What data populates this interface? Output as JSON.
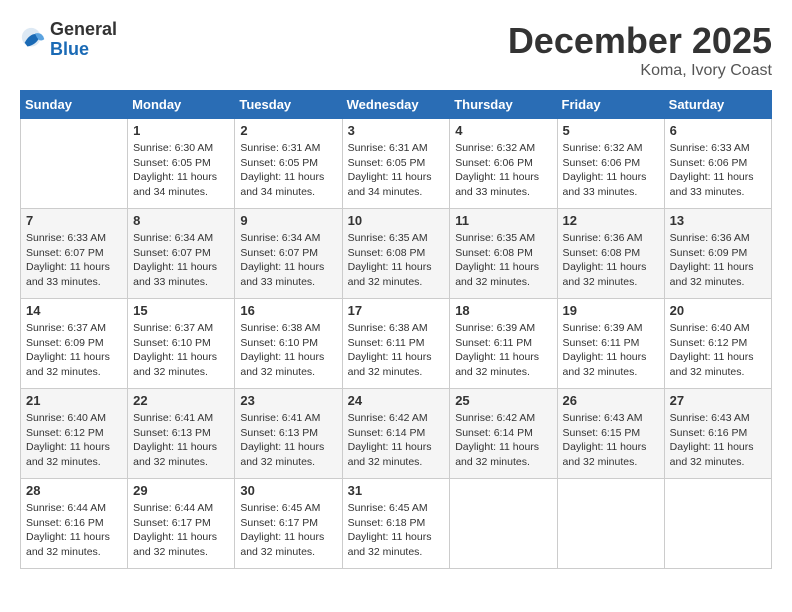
{
  "logo": {
    "general": "General",
    "blue": "Blue"
  },
  "title": "December 2025",
  "location": "Koma, Ivory Coast",
  "days_of_week": [
    "Sunday",
    "Monday",
    "Tuesday",
    "Wednesday",
    "Thursday",
    "Friday",
    "Saturday"
  ],
  "weeks": [
    [
      {
        "day": "",
        "sunrise": "",
        "sunset": "",
        "daylight": ""
      },
      {
        "day": "1",
        "sunrise": "Sunrise: 6:30 AM",
        "sunset": "Sunset: 6:05 PM",
        "daylight": "Daylight: 11 hours and 34 minutes."
      },
      {
        "day": "2",
        "sunrise": "Sunrise: 6:31 AM",
        "sunset": "Sunset: 6:05 PM",
        "daylight": "Daylight: 11 hours and 34 minutes."
      },
      {
        "day": "3",
        "sunrise": "Sunrise: 6:31 AM",
        "sunset": "Sunset: 6:05 PM",
        "daylight": "Daylight: 11 hours and 34 minutes."
      },
      {
        "day": "4",
        "sunrise": "Sunrise: 6:32 AM",
        "sunset": "Sunset: 6:06 PM",
        "daylight": "Daylight: 11 hours and 33 minutes."
      },
      {
        "day": "5",
        "sunrise": "Sunrise: 6:32 AM",
        "sunset": "Sunset: 6:06 PM",
        "daylight": "Daylight: 11 hours and 33 minutes."
      },
      {
        "day": "6",
        "sunrise": "Sunrise: 6:33 AM",
        "sunset": "Sunset: 6:06 PM",
        "daylight": "Daylight: 11 hours and 33 minutes."
      }
    ],
    [
      {
        "day": "7",
        "sunrise": "Sunrise: 6:33 AM",
        "sunset": "Sunset: 6:07 PM",
        "daylight": "Daylight: 11 hours and 33 minutes."
      },
      {
        "day": "8",
        "sunrise": "Sunrise: 6:34 AM",
        "sunset": "Sunset: 6:07 PM",
        "daylight": "Daylight: 11 hours and 33 minutes."
      },
      {
        "day": "9",
        "sunrise": "Sunrise: 6:34 AM",
        "sunset": "Sunset: 6:07 PM",
        "daylight": "Daylight: 11 hours and 33 minutes."
      },
      {
        "day": "10",
        "sunrise": "Sunrise: 6:35 AM",
        "sunset": "Sunset: 6:08 PM",
        "daylight": "Daylight: 11 hours and 32 minutes."
      },
      {
        "day": "11",
        "sunrise": "Sunrise: 6:35 AM",
        "sunset": "Sunset: 6:08 PM",
        "daylight": "Daylight: 11 hours and 32 minutes."
      },
      {
        "day": "12",
        "sunrise": "Sunrise: 6:36 AM",
        "sunset": "Sunset: 6:08 PM",
        "daylight": "Daylight: 11 hours and 32 minutes."
      },
      {
        "day": "13",
        "sunrise": "Sunrise: 6:36 AM",
        "sunset": "Sunset: 6:09 PM",
        "daylight": "Daylight: 11 hours and 32 minutes."
      }
    ],
    [
      {
        "day": "14",
        "sunrise": "Sunrise: 6:37 AM",
        "sunset": "Sunset: 6:09 PM",
        "daylight": "Daylight: 11 hours and 32 minutes."
      },
      {
        "day": "15",
        "sunrise": "Sunrise: 6:37 AM",
        "sunset": "Sunset: 6:10 PM",
        "daylight": "Daylight: 11 hours and 32 minutes."
      },
      {
        "day": "16",
        "sunrise": "Sunrise: 6:38 AM",
        "sunset": "Sunset: 6:10 PM",
        "daylight": "Daylight: 11 hours and 32 minutes."
      },
      {
        "day": "17",
        "sunrise": "Sunrise: 6:38 AM",
        "sunset": "Sunset: 6:11 PM",
        "daylight": "Daylight: 11 hours and 32 minutes."
      },
      {
        "day": "18",
        "sunrise": "Sunrise: 6:39 AM",
        "sunset": "Sunset: 6:11 PM",
        "daylight": "Daylight: 11 hours and 32 minutes."
      },
      {
        "day": "19",
        "sunrise": "Sunrise: 6:39 AM",
        "sunset": "Sunset: 6:11 PM",
        "daylight": "Daylight: 11 hours and 32 minutes."
      },
      {
        "day": "20",
        "sunrise": "Sunrise: 6:40 AM",
        "sunset": "Sunset: 6:12 PM",
        "daylight": "Daylight: 11 hours and 32 minutes."
      }
    ],
    [
      {
        "day": "21",
        "sunrise": "Sunrise: 6:40 AM",
        "sunset": "Sunset: 6:12 PM",
        "daylight": "Daylight: 11 hours and 32 minutes."
      },
      {
        "day": "22",
        "sunrise": "Sunrise: 6:41 AM",
        "sunset": "Sunset: 6:13 PM",
        "daylight": "Daylight: 11 hours and 32 minutes."
      },
      {
        "day": "23",
        "sunrise": "Sunrise: 6:41 AM",
        "sunset": "Sunset: 6:13 PM",
        "daylight": "Daylight: 11 hours and 32 minutes."
      },
      {
        "day": "24",
        "sunrise": "Sunrise: 6:42 AM",
        "sunset": "Sunset: 6:14 PM",
        "daylight": "Daylight: 11 hours and 32 minutes."
      },
      {
        "day": "25",
        "sunrise": "Sunrise: 6:42 AM",
        "sunset": "Sunset: 6:14 PM",
        "daylight": "Daylight: 11 hours and 32 minutes."
      },
      {
        "day": "26",
        "sunrise": "Sunrise: 6:43 AM",
        "sunset": "Sunset: 6:15 PM",
        "daylight": "Daylight: 11 hours and 32 minutes."
      },
      {
        "day": "27",
        "sunrise": "Sunrise: 6:43 AM",
        "sunset": "Sunset: 6:16 PM",
        "daylight": "Daylight: 11 hours and 32 minutes."
      }
    ],
    [
      {
        "day": "28",
        "sunrise": "Sunrise: 6:44 AM",
        "sunset": "Sunset: 6:16 PM",
        "daylight": "Daylight: 11 hours and 32 minutes."
      },
      {
        "day": "29",
        "sunrise": "Sunrise: 6:44 AM",
        "sunset": "Sunset: 6:17 PM",
        "daylight": "Daylight: 11 hours and 32 minutes."
      },
      {
        "day": "30",
        "sunrise": "Sunrise: 6:45 AM",
        "sunset": "Sunset: 6:17 PM",
        "daylight": "Daylight: 11 hours and 32 minutes."
      },
      {
        "day": "31",
        "sunrise": "Sunrise: 6:45 AM",
        "sunset": "Sunset: 6:18 PM",
        "daylight": "Daylight: 11 hours and 32 minutes."
      },
      {
        "day": "",
        "sunrise": "",
        "sunset": "",
        "daylight": ""
      },
      {
        "day": "",
        "sunrise": "",
        "sunset": "",
        "daylight": ""
      },
      {
        "day": "",
        "sunrise": "",
        "sunset": "",
        "daylight": ""
      }
    ]
  ]
}
